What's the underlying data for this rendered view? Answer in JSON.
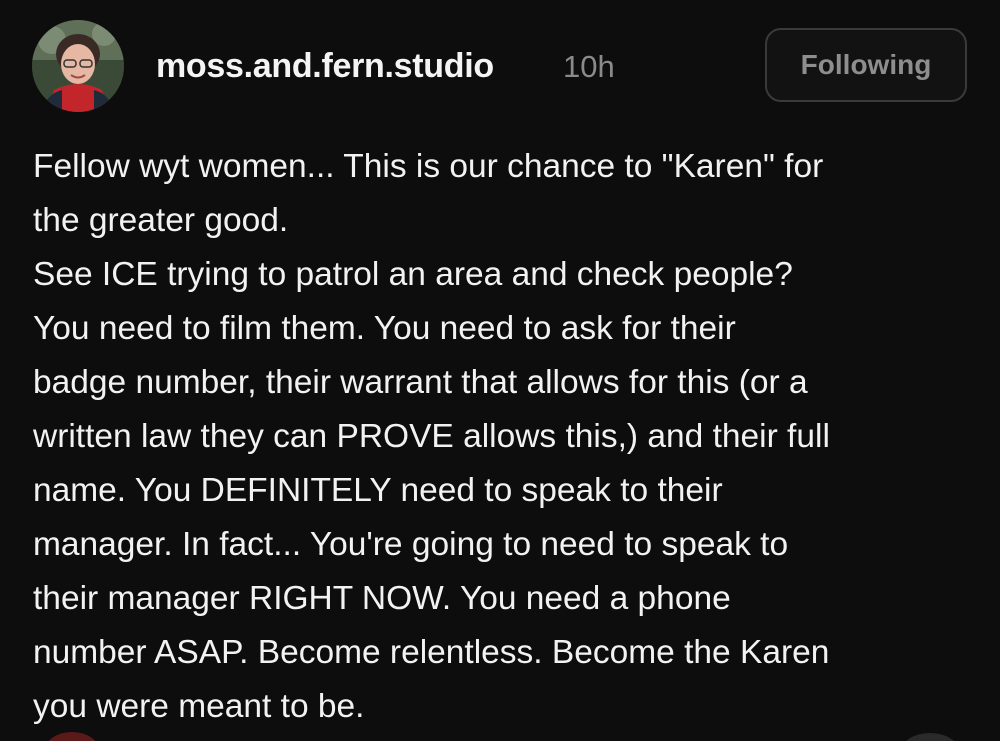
{
  "post": {
    "author": {
      "username": "moss.and.fern.studio",
      "avatar_icon": "profile-photo-avatar"
    },
    "timestamp": "10h",
    "follow_button_label": "Following",
    "lines": [
      "Fellow wyt women... This is our chance to \"Karen\" for",
      "the greater good.",
      "See ICE trying to patrol an area and check people?",
      "You need to film them. You need to ask for their",
      "badge number, their warrant that allows for this (or a",
      "written law they can PROVE allows this,) and their full",
      "name. You DEFINITELY need to speak to their",
      "manager. In fact... You're going to need to speak to",
      "their manager RIGHT NOW. You need a phone",
      "number ASAP. Become relentless. Become the Karen",
      "you were meant to be."
    ]
  },
  "colors": {
    "background": "#0d0d0d",
    "text": "#f2f2f2",
    "muted": "#8a8a8a",
    "button_border": "#3a3a3a"
  }
}
